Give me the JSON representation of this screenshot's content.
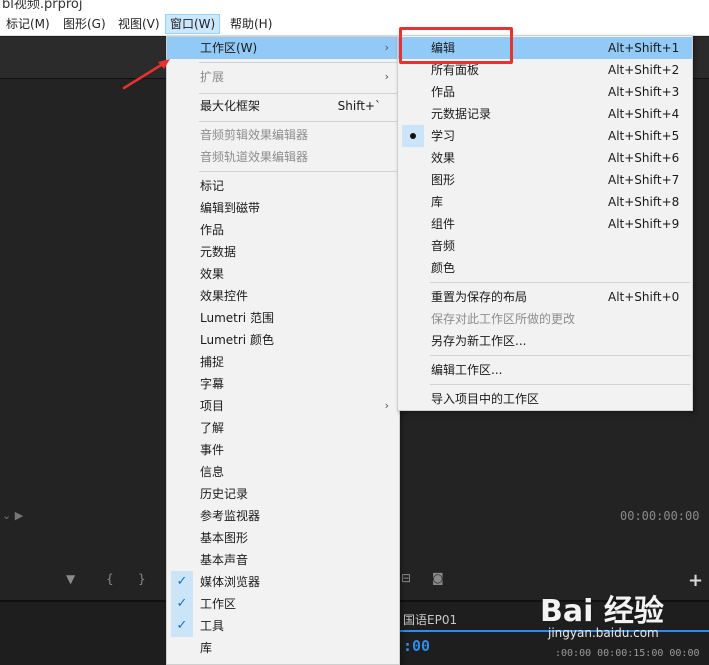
{
  "window": {
    "title": "bl视频.prproj"
  },
  "menubar": {
    "items": [
      {
        "label": "标记(M)"
      },
      {
        "label": "图形(G)"
      },
      {
        "label": "视图(V)"
      },
      {
        "label": "窗口(W)"
      },
      {
        "label": "帮助(H)"
      }
    ]
  },
  "window_menu": {
    "items": [
      {
        "label": "工作区(W)"
      },
      {
        "label": "扩展"
      },
      {
        "label": "最大化框架",
        "shortcut": "Shift+`"
      },
      {
        "label": "音频剪辑效果编辑器"
      },
      {
        "label": "音频轨道效果编辑器"
      },
      {
        "label": "标记"
      },
      {
        "label": "编辑到磁带"
      },
      {
        "label": "作品"
      },
      {
        "label": "元数据"
      },
      {
        "label": "效果"
      },
      {
        "label": "效果控件"
      },
      {
        "label": "Lumetri 范围"
      },
      {
        "label": "Lumetri 颜色"
      },
      {
        "label": "捕捉"
      },
      {
        "label": "字幕"
      },
      {
        "label": "项目"
      },
      {
        "label": "了解"
      },
      {
        "label": "事件"
      },
      {
        "label": "信息"
      },
      {
        "label": "历史记录"
      },
      {
        "label": "参考监视器"
      },
      {
        "label": "基本图形"
      },
      {
        "label": "基本声音"
      },
      {
        "label": "媒体浏览器"
      },
      {
        "label": "工作区"
      },
      {
        "label": "工具"
      },
      {
        "label": "库"
      }
    ]
  },
  "workspace_submenu": {
    "items": [
      {
        "label": "编辑",
        "shortcut": "Alt+Shift+1"
      },
      {
        "label": "所有面板",
        "shortcut": "Alt+Shift+2"
      },
      {
        "label": "作品",
        "shortcut": "Alt+Shift+3"
      },
      {
        "label": "元数据记录",
        "shortcut": "Alt+Shift+4"
      },
      {
        "label": "学习",
        "shortcut": "Alt+Shift+5"
      },
      {
        "label": "效果",
        "shortcut": "Alt+Shift+6"
      },
      {
        "label": "图形",
        "shortcut": "Alt+Shift+7"
      },
      {
        "label": "库",
        "shortcut": "Alt+Shift+8"
      },
      {
        "label": "组件",
        "shortcut": "Alt+Shift+9"
      },
      {
        "label": "音频"
      },
      {
        "label": "颜色"
      },
      {
        "label": "重置为保存的布局",
        "shortcut": "Alt+Shift+0"
      },
      {
        "label": "保存对此工作区所做的更改"
      },
      {
        "label": "另存为新工作区..."
      },
      {
        "label": "编辑工作区..."
      },
      {
        "label": "导入项目中的工作区"
      }
    ]
  },
  "panels": {
    "timecode_right": "00:00:00:00",
    "sequence_tab": "国语EP01",
    "sequence_timecode": ":00",
    "ruler": ":00:00    00:00:15:00    00:00"
  },
  "watermark": {
    "logo": "Bai 经验",
    "url": "jingyan.baidu.com"
  },
  "colors": {
    "highlight": "#91c9f7",
    "check_bg": "#cce4f7",
    "annotation_red": "#e8322e",
    "timeline_blue": "#2d8ceb"
  }
}
